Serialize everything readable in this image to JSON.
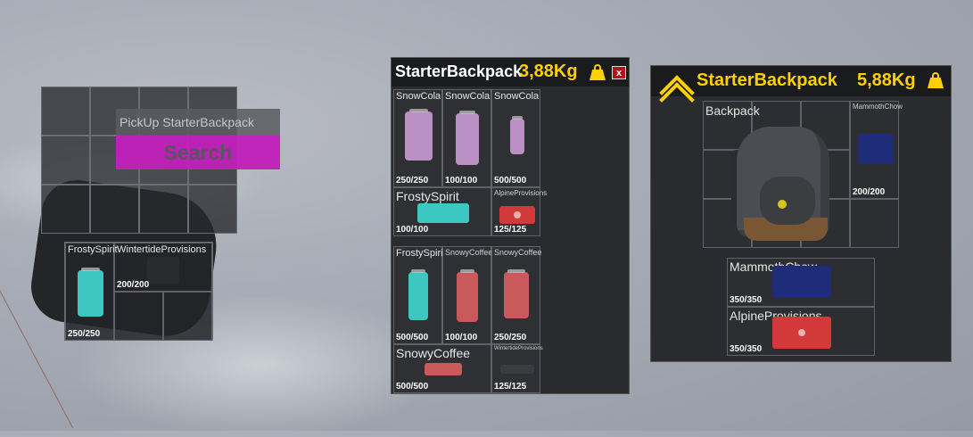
{
  "world": {
    "pickup_tooltip": "PickUp StarterBackpack",
    "search_label": "Search",
    "floor_items": [
      {
        "name": "FrostySpirit",
        "qty": "250/250",
        "color": "#3cc7c0"
      },
      {
        "name": "WintertideProvisions",
        "qty": "200/200",
        "color": "#2a2b2e"
      }
    ]
  },
  "middle_panel": {
    "title": "StarterBackpack",
    "weight": "3,88Kg",
    "close_label": "x",
    "items": [
      {
        "name": "SnowCola",
        "qty": "250/250",
        "color": "#b98fc4"
      },
      {
        "name": "SnowCola",
        "qty": "100/100",
        "color": "#b98fc4"
      },
      {
        "name": "SnowCola",
        "qty": "500/500",
        "color": "#b98fc4"
      },
      {
        "name": "FrostySpirit",
        "qty": "100/100",
        "color": "#3cc7c0"
      },
      {
        "name": "AlpineProvisions",
        "qty": "125/125",
        "color": "#d23a3a"
      },
      {
        "name": "FrostySpirit",
        "qty": "500/500",
        "color": "#3cc7c0"
      },
      {
        "name": "SnowyCoffee",
        "qty": "100/100",
        "color": "#c9595b"
      },
      {
        "name": "SnowyCoffee",
        "qty": "250/250",
        "color": "#c9595b"
      },
      {
        "name": "SnowyCoffee",
        "qty": "500/500",
        "color": "#c9595b"
      },
      {
        "name": "WintertideProvisions",
        "qty": "125/125",
        "color": "#3b3c40"
      }
    ]
  },
  "right_panel": {
    "title": "StarterBackpack",
    "weight": "5,88Kg",
    "backpack_label": "Backpack",
    "items": [
      {
        "name": "MammothChow",
        "qty": "200/200",
        "color": "#1f2c7a"
      },
      {
        "name": "MammothChow",
        "qty": "350/350",
        "color": "#1f2c7a"
      },
      {
        "name": "AlpineProvisions",
        "qty": "350/350",
        "color": "#d23a3a"
      }
    ]
  },
  "colors": {
    "accent": "#ffd000",
    "search_button": "#c21fba",
    "close_button": "#b3121a",
    "panel_bg": "#2a2b2e"
  },
  "icons": [
    "weight-icon",
    "close-icon",
    "chevron-up-icon",
    "backpack-icon"
  ]
}
